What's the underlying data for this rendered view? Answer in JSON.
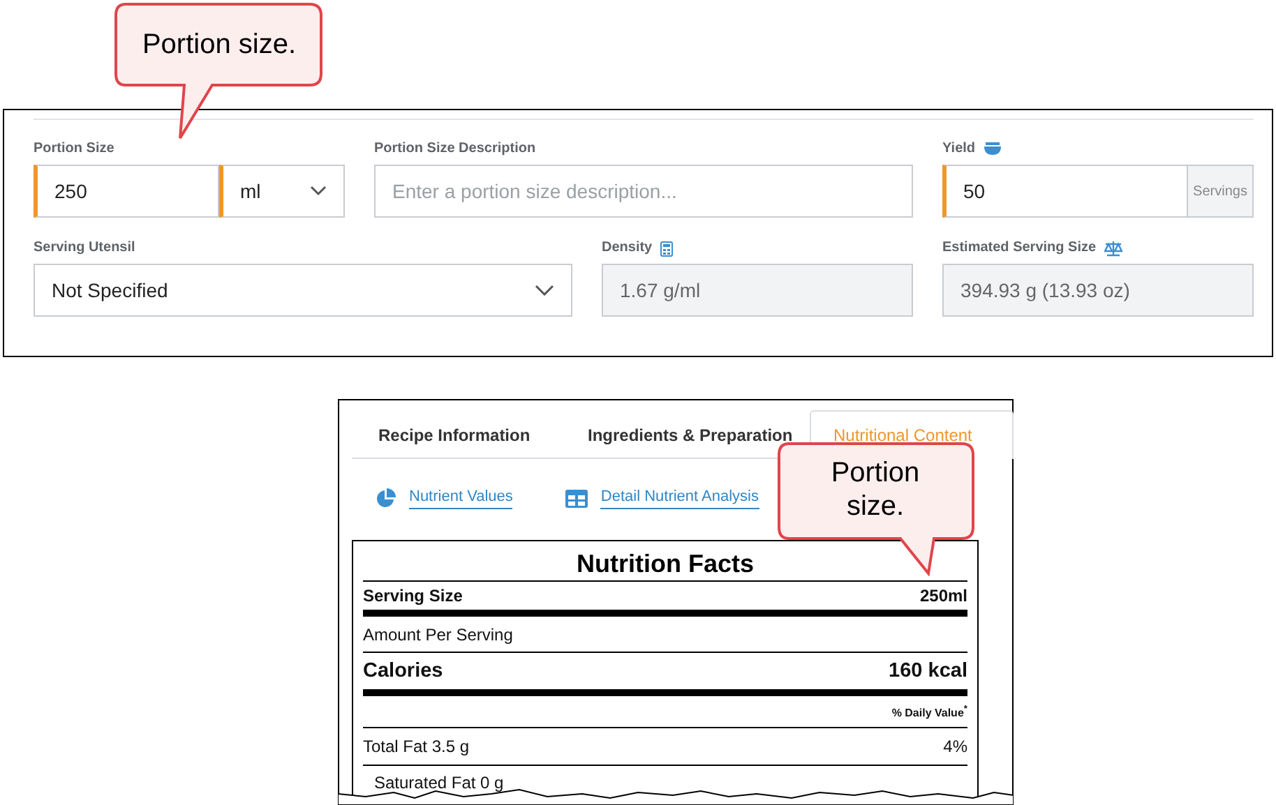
{
  "portion_panel": {
    "callout": "Portion size.",
    "portion_size": {
      "label": "Portion Size",
      "value": "250",
      "unit": "ml",
      "required": true
    },
    "description": {
      "label": "Portion Size Description",
      "placeholder": "Enter a portion size description..."
    },
    "yield": {
      "label": "Yield",
      "value": "50",
      "unit": "Servings",
      "required": true
    },
    "serving_utensil": {
      "label": "Serving Utensil",
      "value": "Not Specified"
    },
    "density": {
      "label": "Density",
      "value": "1.67 g/ml"
    },
    "estimated_serving_size": {
      "label": "Estimated Serving Size",
      "value": "394.93 g (13.93 oz)"
    }
  },
  "recipe_panel": {
    "callout": "Portion size.",
    "tabs": [
      {
        "label": "Recipe Information",
        "selected": false
      },
      {
        "label": "Ingredients & Preparation",
        "selected": false
      },
      {
        "label": "Nutritional Content",
        "selected": true
      }
    ],
    "links": [
      {
        "kind": "pie",
        "label": "Nutrient Values"
      },
      {
        "kind": "table",
        "label": "Detail Nutrient Analysis"
      }
    ],
    "nutrition_facts": {
      "title": "Nutrition Facts",
      "rows": [
        {
          "kind": "serving",
          "label": "Serving Size",
          "value": "250ml"
        },
        {
          "kind": "plain",
          "label": "Amount Per Serving"
        },
        {
          "kind": "calories",
          "label": "Calories",
          "value": "160 kcal"
        },
        {
          "kind": "dv_header",
          "value": "% Daily Value$^{*}$"
        },
        {
          "kind": "nutrient",
          "label": "Total Fat 3.5 g",
          "value": "4%"
        },
        {
          "kind": "sub",
          "label": "Saturated Fat 0 g"
        }
      ]
    }
  }
}
